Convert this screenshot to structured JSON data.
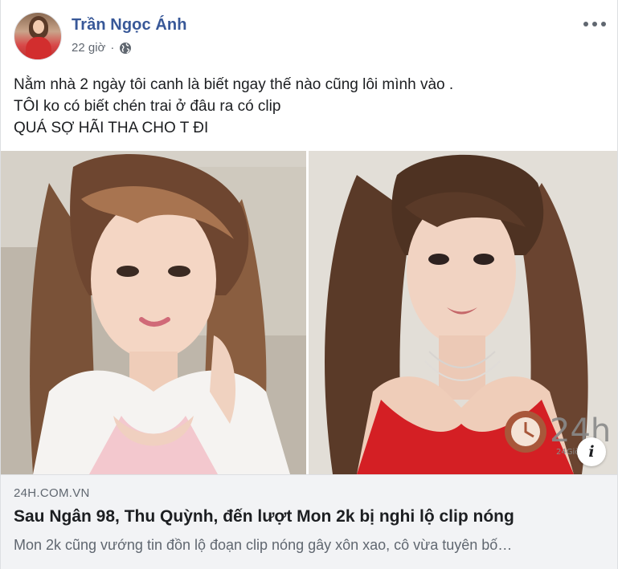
{
  "post": {
    "author_name": "Trần Ngọc Ánh",
    "time": "22 giờ",
    "separator": "·",
    "privacy_icon": "globe-icon",
    "more_icon": "more-options-icon",
    "text_lines": [
      "Nằm nhà 2 ngày tôi canh là biết ngay thế nào cũng lôi mình vào .",
      "TÔI ko có biết chén trai ở đâu ra có clip",
      "QUÁ SỢ HÃI THA CHO T ĐI"
    ]
  },
  "link_preview": {
    "watermark": "24h",
    "watermark_sub": "24Giờ",
    "info_label": "i",
    "domain": "24H.COM.VN",
    "title": "Sau Ngân 98, Thu Quỳnh, đến lượt Mon 2k bị nghi lộ clip nóng",
    "description": "Mon 2k cũng vướng tin đồn lộ đoạn clip nóng gây xôn xao, cô vừa tuyên bố…"
  },
  "colors": {
    "author": "#385898",
    "text": "#1c1e21",
    "secondary": "#606770",
    "link_bg": "#f2f3f5"
  }
}
